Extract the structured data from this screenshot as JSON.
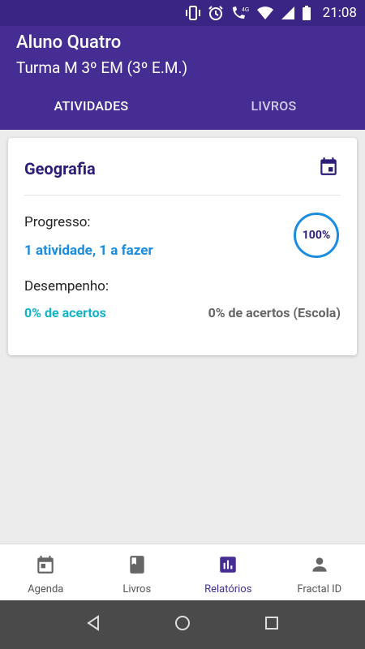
{
  "status": {
    "time": "21:08",
    "network": "4G"
  },
  "header": {
    "student_name": "Aluno Quatro",
    "class_name": "Turma M 3º EM (3º E.M.)"
  },
  "tabs": [
    {
      "label": "ATIVIDADES",
      "active": true
    },
    {
      "label": "LIVROS",
      "active": false
    }
  ],
  "card": {
    "subject": "Geografia",
    "progress_label": "Progresso:",
    "progress_value": "1 atividade, 1 a fazer",
    "progress_percent": "100%",
    "performance_label": "Desempenho:",
    "performance_value": "0% de acertos",
    "performance_school": "0% de acertos (Escola)"
  },
  "bottom_nav": [
    {
      "label": "Agenda",
      "icon": "calendar-icon"
    },
    {
      "label": "Livros",
      "icon": "book-icon"
    },
    {
      "label": "Relatórios",
      "icon": "bar-chart-icon",
      "active": true
    },
    {
      "label": "Fractal ID",
      "icon": "person-icon"
    }
  ],
  "colors": {
    "primary": "#452d94",
    "status_bar": "#3a2585",
    "blue": "#1a8de0",
    "cyan": "#12b3c9"
  }
}
